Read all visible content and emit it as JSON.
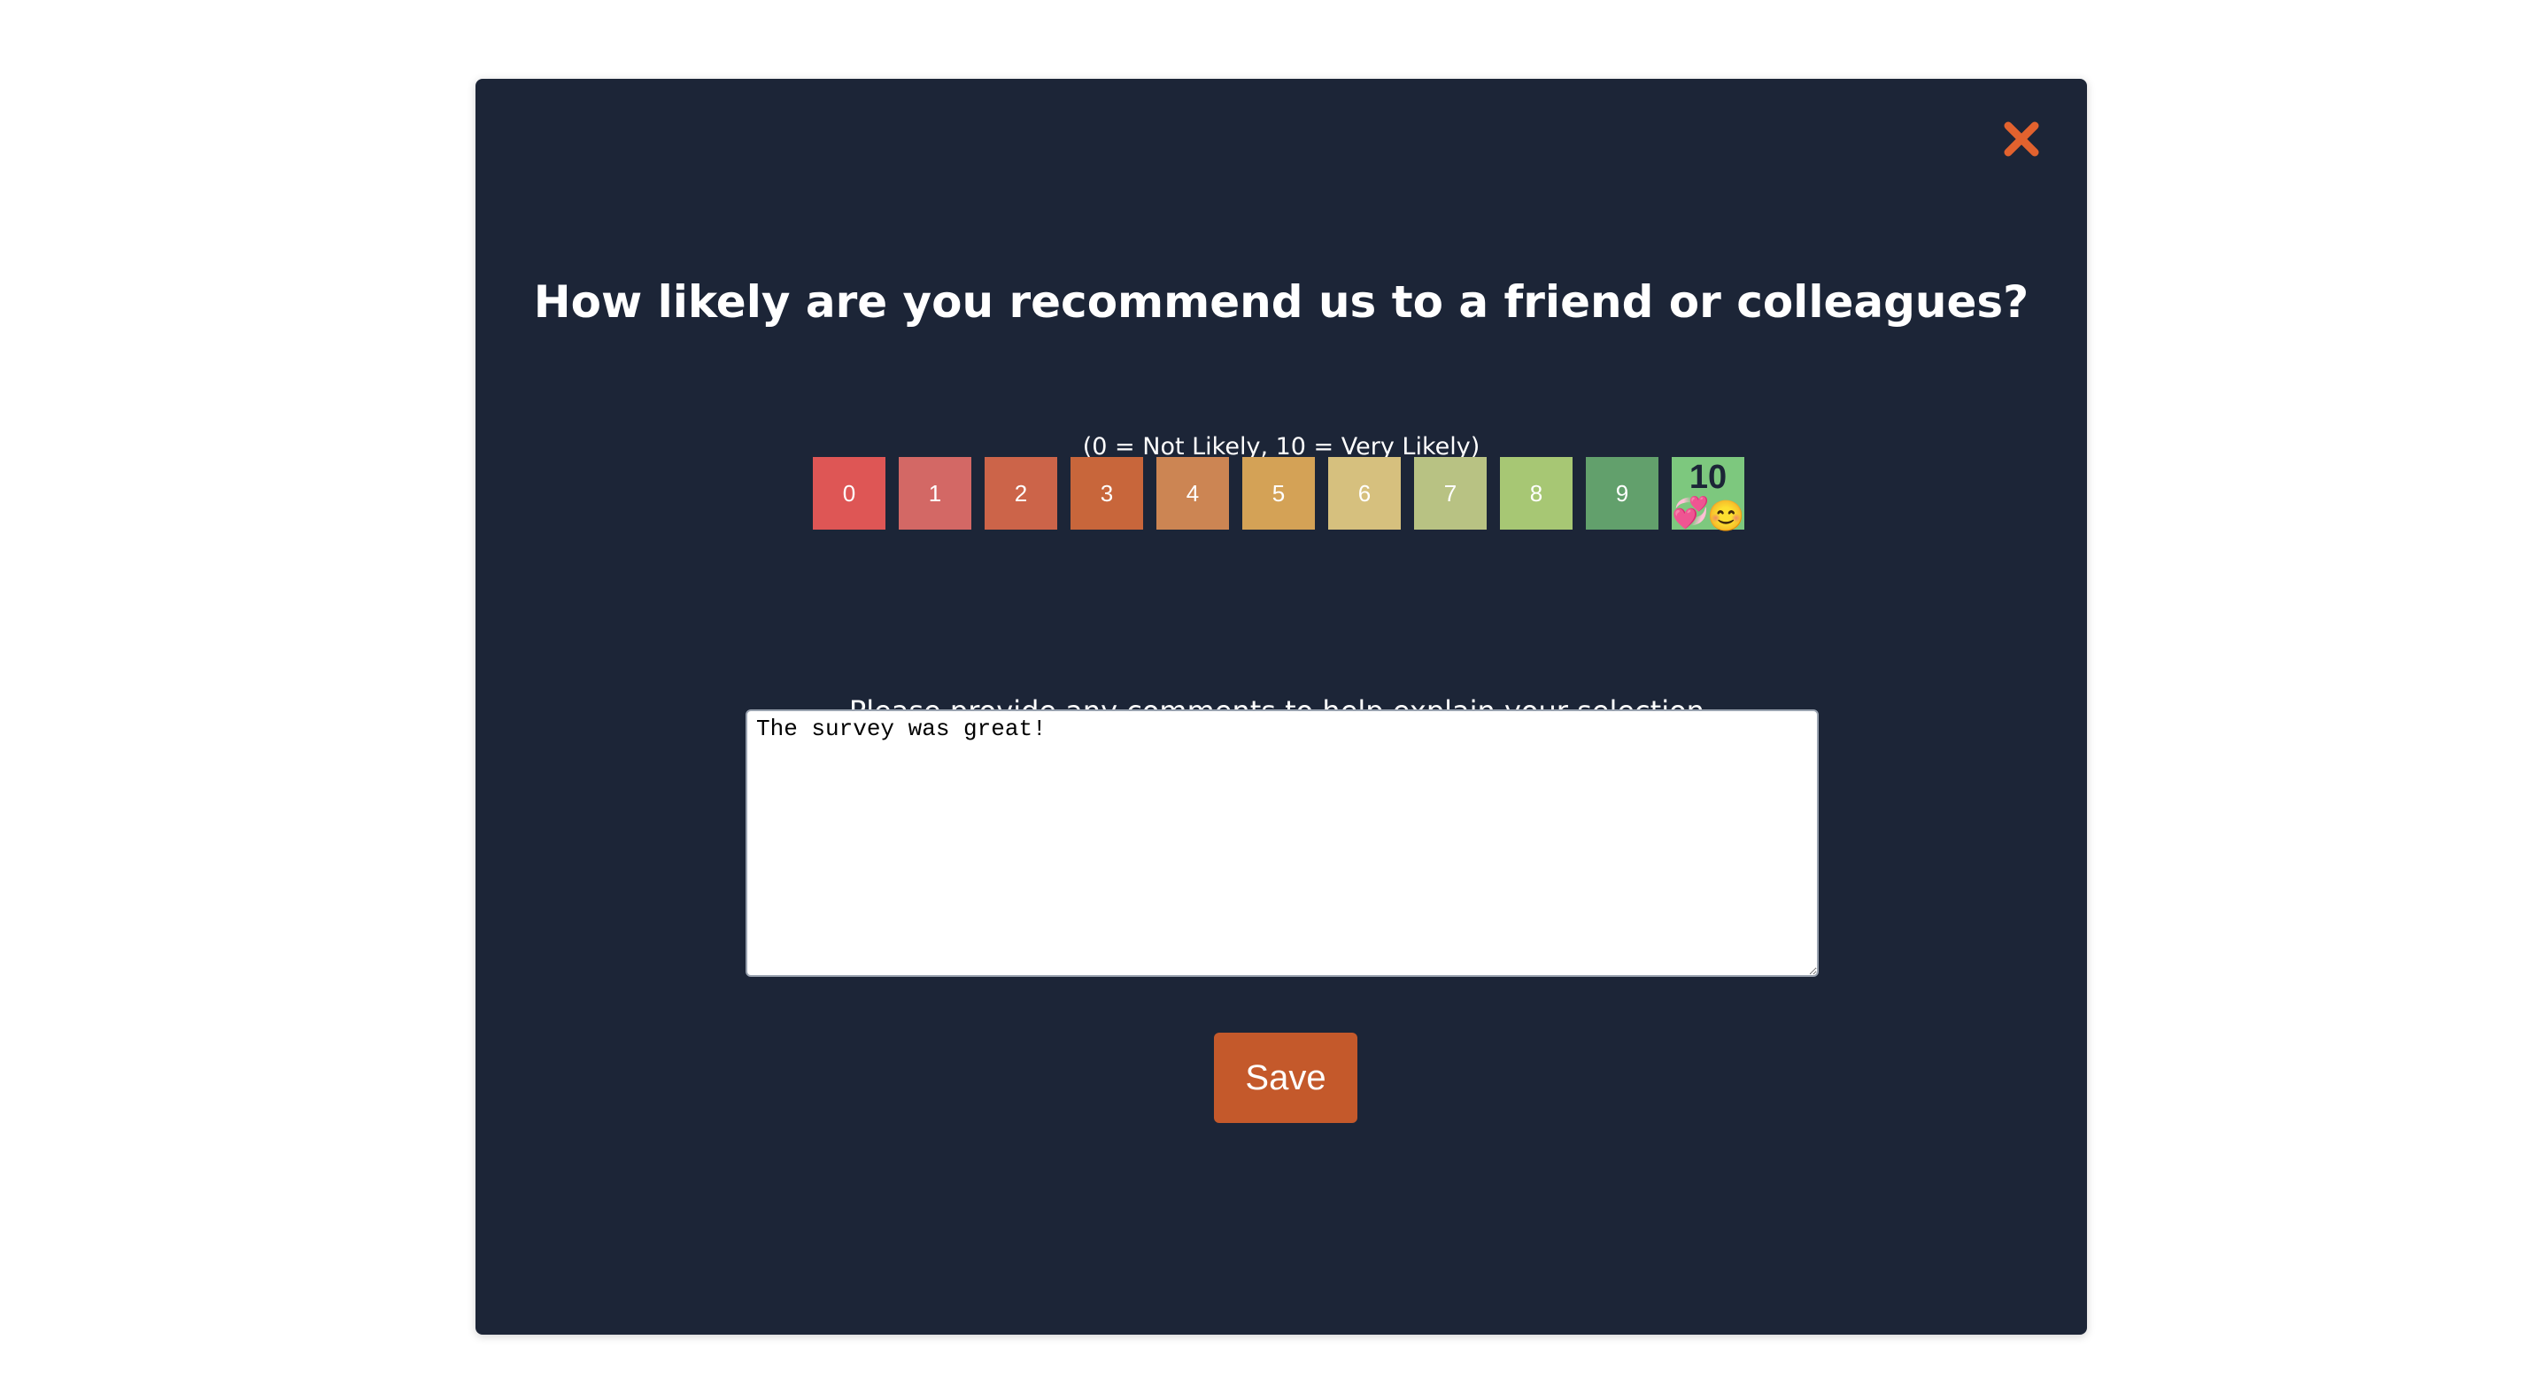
{
  "modal": {
    "title": "How likely are you recommend us to a friend or colleagues?",
    "scale_hint": "(0 = Not Likely, 10 = Very Likely)",
    "scores": [
      {
        "label": "0",
        "color": "#de5655"
      },
      {
        "label": "1",
        "color": "#d36865"
      },
      {
        "label": "2",
        "color": "#cc6449"
      },
      {
        "label": "3",
        "color": "#c8663b"
      },
      {
        "label": "4",
        "color": "#cc8553"
      },
      {
        "label": "5",
        "color": "#d4a256"
      },
      {
        "label": "6",
        "color": "#d6c07e"
      },
      {
        "label": "7",
        "color": "#b8c283"
      },
      {
        "label": "8",
        "color": "#a7c774"
      },
      {
        "label": "9",
        "color": "#62a06c"
      },
      {
        "label": "10",
        "color": "#7dc87e"
      }
    ],
    "selected_score": "10",
    "selected_emojis": [
      "💞",
      "😊"
    ],
    "comment_prompt": "Please provide any comments to help explain your selection.",
    "comment_value": "The survey was great!",
    "save_label": "Save",
    "close_icon": "close-x-icon",
    "accent_color": "#e2622e"
  }
}
